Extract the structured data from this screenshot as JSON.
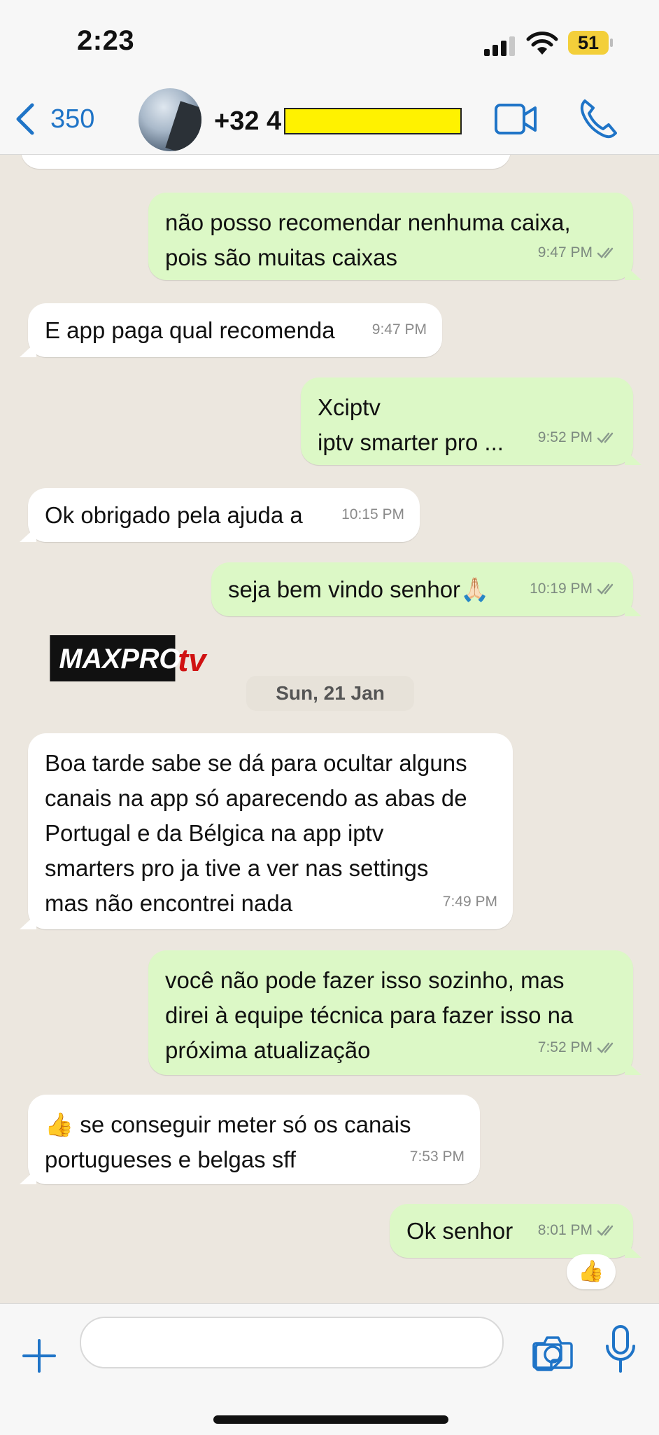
{
  "status": {
    "time": "2:23",
    "battery": "51"
  },
  "header": {
    "back_count": "350",
    "contact_prefix": "+32 4"
  },
  "chat": {
    "date_separator": "Sun, 21 Jan",
    "logo_text": "MAXPRO tv",
    "messages": [
      {
        "dir": "out",
        "text": "não posso recomendar nenhuma caixa,\npois são muitas caixas",
        "time": "9:47 PM"
      },
      {
        "dir": "in",
        "text": "E app paga qual recomenda",
        "time": "9:47 PM"
      },
      {
        "dir": "out",
        "text": "Xciptv\niptv smarter pro ...",
        "time": "9:52 PM"
      },
      {
        "dir": "in",
        "text": "Ok obrigado pela ajuda a",
        "time": "10:15 PM"
      },
      {
        "dir": "out",
        "text": "seja bem vindo senhor🙏🏻",
        "time": "10:19 PM"
      },
      {
        "dir": "in",
        "text": "Boa tarde sabe se dá para ocultar alguns\ncanais na app só aparecendo as abas de\nPortugal e da Bélgica na app iptv\nsmarters pro ja tive a ver nas settings\nmas não encontrei nada",
        "time": "7:49 PM"
      },
      {
        "dir": "out",
        "text": "você não pode fazer isso sozinho, mas\ndirei à equipe técnica para fazer isso na\npróxima atualização",
        "time": "7:52 PM"
      },
      {
        "dir": "in",
        "text": "👍 se conseguir meter só os canais\nportugueses e belgas sff",
        "time": "7:53 PM"
      },
      {
        "dir": "out",
        "text": "Ok senhor",
        "time": "8:01 PM"
      }
    ],
    "reaction": "👍"
  },
  "icons": {
    "back": "chevron-left-icon",
    "video": "video-camera-icon",
    "call": "phone-icon",
    "plus": "plus-icon",
    "sticker": "sticker-icon",
    "camera": "camera-icon",
    "mic": "microphone-icon"
  },
  "colors": {
    "accent": "#1f74c7",
    "outgoing_bubble": "#dcf8c6",
    "incoming_bubble": "#ffffff",
    "chat_bg": "#ece7df",
    "redaction": "#fff200"
  }
}
